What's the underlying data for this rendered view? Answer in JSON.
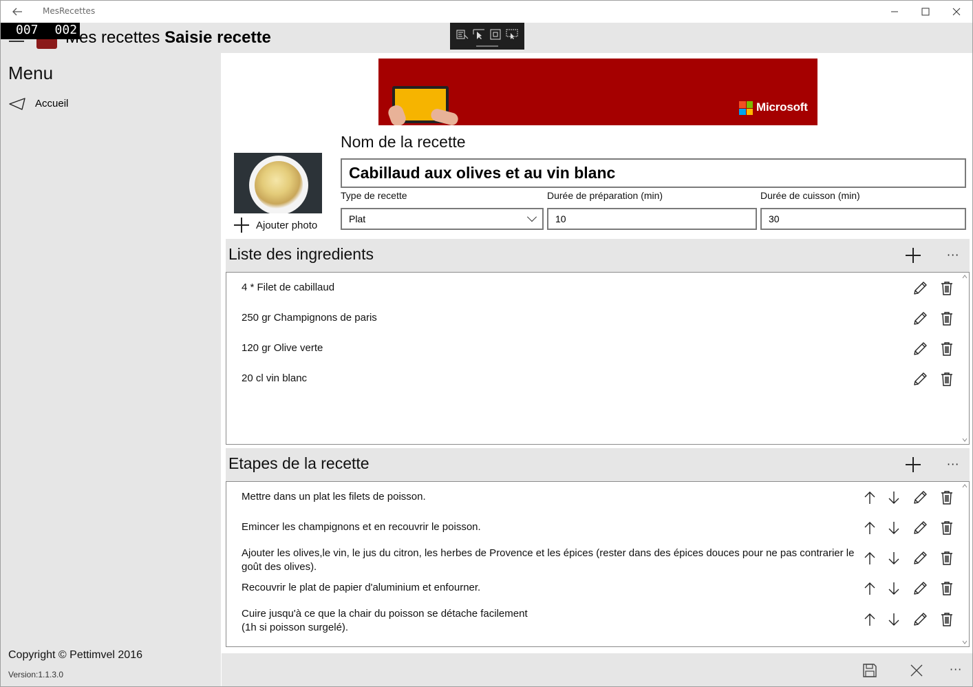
{
  "window": {
    "app_title": "MesRecettes"
  },
  "overlay_counter": {
    "left": "007",
    "right": "002"
  },
  "header": {
    "title_prefix": "Mes recettes",
    "title_page": "Saisie recette"
  },
  "sidebar": {
    "menu_title": "Menu",
    "items": [
      {
        "label": "Accueil",
        "icon": "send-icon"
      }
    ],
    "copyright": "Copyright © Pettimvel 2016",
    "version": "Version:1.1.3.0"
  },
  "ad": {
    "brand": "Microsoft",
    "colors": {
      "background": "#a50000",
      "ms_red": "#f25022",
      "ms_green": "#7fba00",
      "ms_blue": "#00a4ef",
      "ms_yellow": "#ffb900"
    }
  },
  "recipe": {
    "add_photo_label": "Ajouter photo",
    "name_label": "Nom de la recette",
    "name_value": "Cabillaud aux olives et au vin blanc",
    "type_label": "Type de recette",
    "type_value": "Plat",
    "prep_label": "Durée de préparation (min)",
    "prep_value": "10",
    "cook_label": "Durée de cuisson (min)",
    "cook_value": "30"
  },
  "ingredients": {
    "title": "Liste des ingredients",
    "items": [
      {
        "text": "4  *  Filet de cabillaud"
      },
      {
        "text": "250  gr  Champignons de paris"
      },
      {
        "text": "120  gr  Olive verte"
      },
      {
        "text": "20  cl  vin blanc"
      }
    ]
  },
  "steps": {
    "title": "Etapes de la recette",
    "items": [
      {
        "line1": "Mettre dans un plat les filets de poisson.",
        "line2": ""
      },
      {
        "line1": "Emincer les champignons et en recouvrir le poisson.",
        "line2": ""
      },
      {
        "line1": "Ajouter les olives,le vin, le jus du citron, les herbes de Provence et les épices (rester dans des épices douces pour ne pas contrarier le",
        "line2": "goût des olives)."
      },
      {
        "line1": "Recouvrir le plat de papier d'aluminium et enfourner.",
        "line2": ""
      },
      {
        "line1": "Cuire jusqu'à ce que la chair du poisson se détache facilement",
        "line2": "(1h si poisson surgelé)."
      }
    ]
  },
  "more_glyph": "···",
  "colors": {
    "chrome": "#e6e6e6",
    "border": "#7a7a7a"
  }
}
